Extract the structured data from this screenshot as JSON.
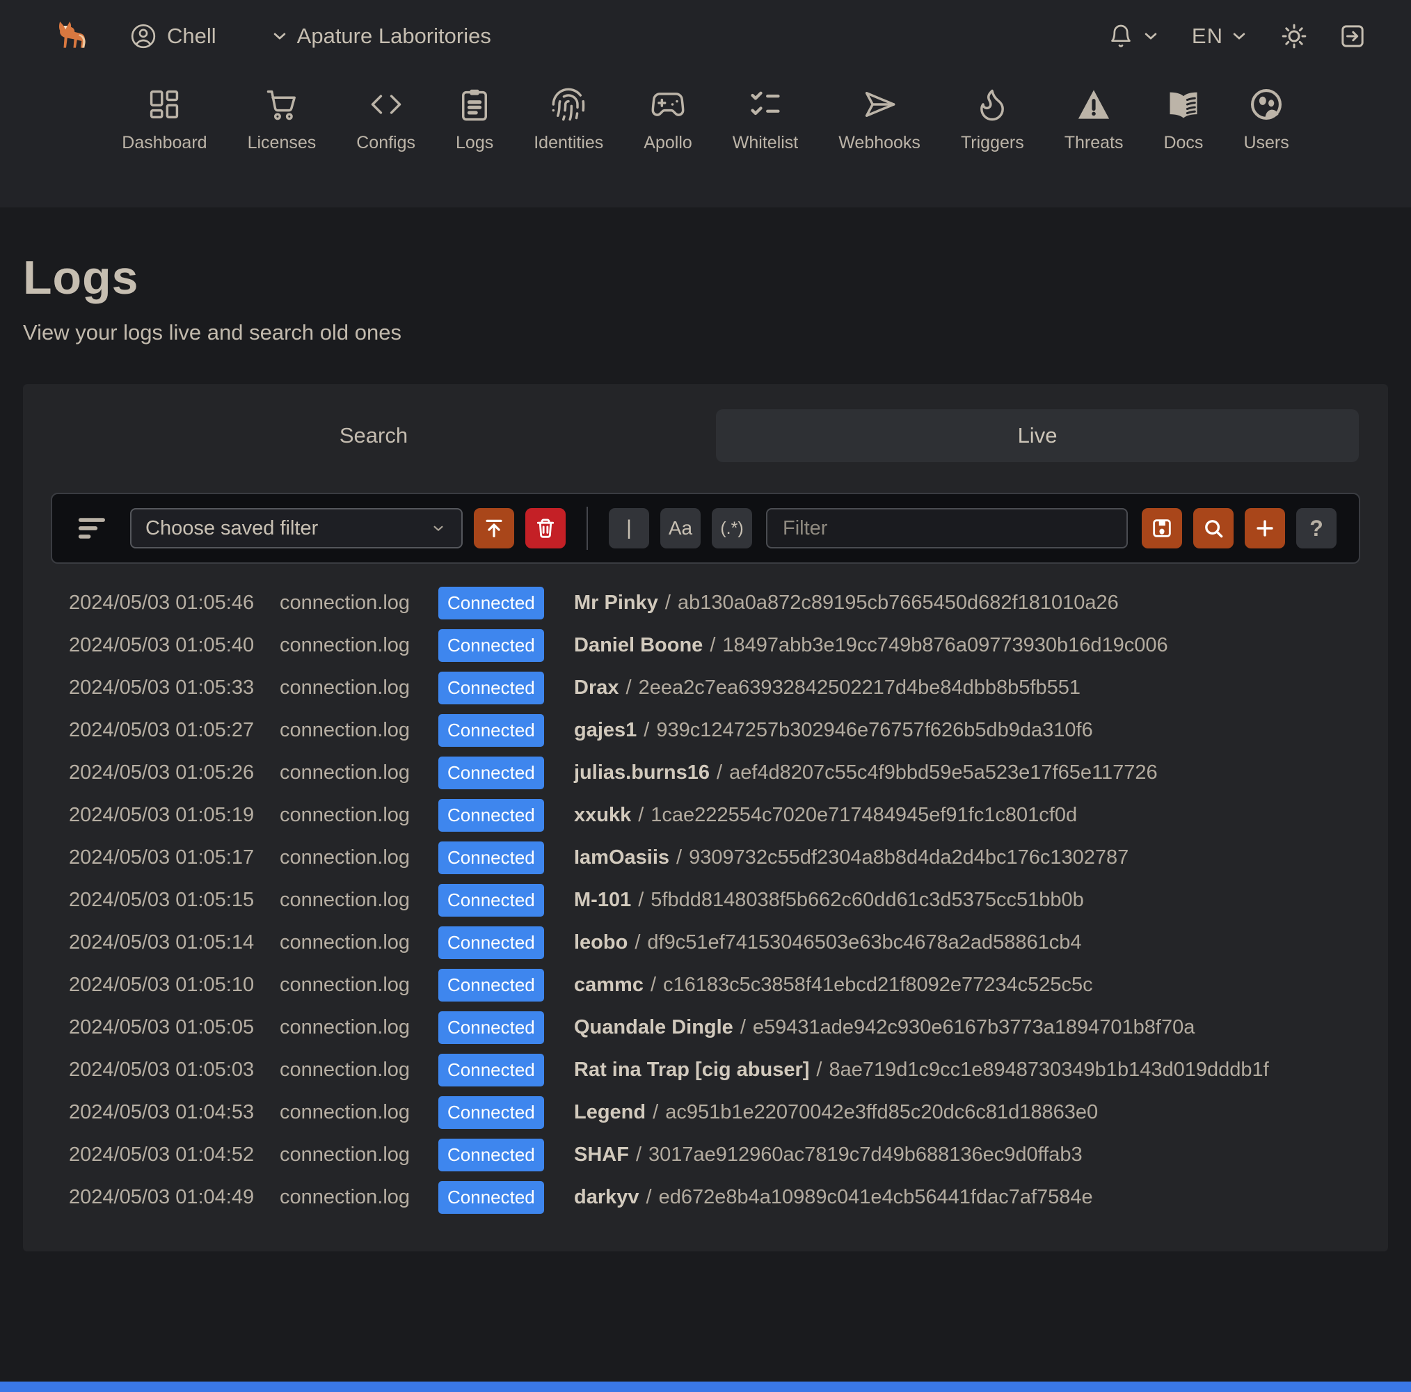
{
  "header": {
    "user_name": "Chell",
    "org_name": "Apature Laboritories",
    "language": "EN",
    "nav": [
      {
        "label": "Dashboard",
        "icon": "dashboard-icon"
      },
      {
        "label": "Licenses",
        "icon": "cart-icon"
      },
      {
        "label": "Configs",
        "icon": "code-icon"
      },
      {
        "label": "Logs",
        "icon": "clipboard-icon"
      },
      {
        "label": "Identities",
        "icon": "fingerprint-icon"
      },
      {
        "label": "Apollo",
        "icon": "gamepad-icon"
      },
      {
        "label": "Whitelist",
        "icon": "checklist-icon"
      },
      {
        "label": "Webhooks",
        "icon": "send-icon"
      },
      {
        "label": "Triggers",
        "icon": "flame-icon"
      },
      {
        "label": "Threats",
        "icon": "warning-icon"
      },
      {
        "label": "Docs",
        "icon": "book-icon"
      },
      {
        "label": "Users",
        "icon": "users-icon"
      }
    ]
  },
  "page": {
    "title": "Logs",
    "subtitle": "View your logs live and search old ones"
  },
  "tabs": {
    "search_label": "Search",
    "live_label": "Live",
    "active": "Live"
  },
  "toolbar": {
    "saved_filter_value": "Choose saved filter",
    "filter_placeholder": "Filter",
    "filter_value": "",
    "pipe_label": "|",
    "case_label": "Aa",
    "regex_label": "(.*)",
    "help_label": "?"
  },
  "logs_separator": "/",
  "logs": [
    {
      "time": "2024/05/03 01:05:46",
      "file": "connection.log",
      "status": "Connected",
      "name": "Mr Pinky",
      "hash": "ab130a0a872c89195cb7665450d682f181010a26"
    },
    {
      "time": "2024/05/03 01:05:40",
      "file": "connection.log",
      "status": "Connected",
      "name": "Daniel Boone",
      "hash": "18497abb3e19cc749b876a09773930b16d19c006"
    },
    {
      "time": "2024/05/03 01:05:33",
      "file": "connection.log",
      "status": "Connected",
      "name": "Drax",
      "hash": "2eea2c7ea63932842502217d4be84dbb8b5fb551"
    },
    {
      "time": "2024/05/03 01:05:27",
      "file": "connection.log",
      "status": "Connected",
      "name": "gajes1",
      "hash": "939c1247257b302946e76757f626b5db9da310f6"
    },
    {
      "time": "2024/05/03 01:05:26",
      "file": "connection.log",
      "status": "Connected",
      "name": "julias.burns16",
      "hash": "aef4d8207c55c4f9bbd59e5a523e17f65e117726"
    },
    {
      "time": "2024/05/03 01:05:19",
      "file": "connection.log",
      "status": "Connected",
      "name": "xxukk",
      "hash": "1cae222554c7020e717484945ef91fc1c801cf0d"
    },
    {
      "time": "2024/05/03 01:05:17",
      "file": "connection.log",
      "status": "Connected",
      "name": "IamOasiis",
      "hash": "9309732c55df2304a8b8d4da2d4bc176c1302787"
    },
    {
      "time": "2024/05/03 01:05:15",
      "file": "connection.log",
      "status": "Connected",
      "name": "M-101",
      "hash": "5fbdd8148038f5b662c60dd61c3d5375cc51bb0b"
    },
    {
      "time": "2024/05/03 01:05:14",
      "file": "connection.log",
      "status": "Connected",
      "name": "leobo",
      "hash": "df9c51ef74153046503e63bc4678a2ad58861cb4"
    },
    {
      "time": "2024/05/03 01:05:10",
      "file": "connection.log",
      "status": "Connected",
      "name": "cammc",
      "hash": "c16183c5c3858f41ebcd21f8092e77234c525c5c"
    },
    {
      "time": "2024/05/03 01:05:05",
      "file": "connection.log",
      "status": "Connected",
      "name": "Quandale Dingle",
      "hash": "e59431ade942c930e6167b3773a1894701b8f70a"
    },
    {
      "time": "2024/05/03 01:05:03",
      "file": "connection.log",
      "status": "Connected",
      "name": "Rat ina Trap [cig abuser]",
      "hash": "8ae719d1c9cc1e8948730349b1b143d019dddb1f"
    },
    {
      "time": "2024/05/03 01:04:53",
      "file": "connection.log",
      "status": "Connected",
      "name": "Legend",
      "hash": "ac951b1e22070042e3ffd85c20dc6c81d18863e0"
    },
    {
      "time": "2024/05/03 01:04:52",
      "file": "connection.log",
      "status": "Connected",
      "name": "SHAF",
      "hash": "3017ae912960ac7819c7d49b688136ec9d0ffab3"
    },
    {
      "time": "2024/05/03 01:04:49",
      "file": "connection.log",
      "status": "Connected",
      "name": "darkyv",
      "hash": "ed672e8b4a10989c041e4cb56441fdac7af7584e"
    }
  ],
  "colors": {
    "page_bg": "#1a1b1e",
    "header_bg": "#222327",
    "panel_bg": "#242528",
    "accent_orange": "#a9461a",
    "danger_red": "#c42026",
    "badge_blue": "#3e86ee",
    "bottom_bar_blue": "#3a78e8",
    "text": "#c9c1b4"
  }
}
